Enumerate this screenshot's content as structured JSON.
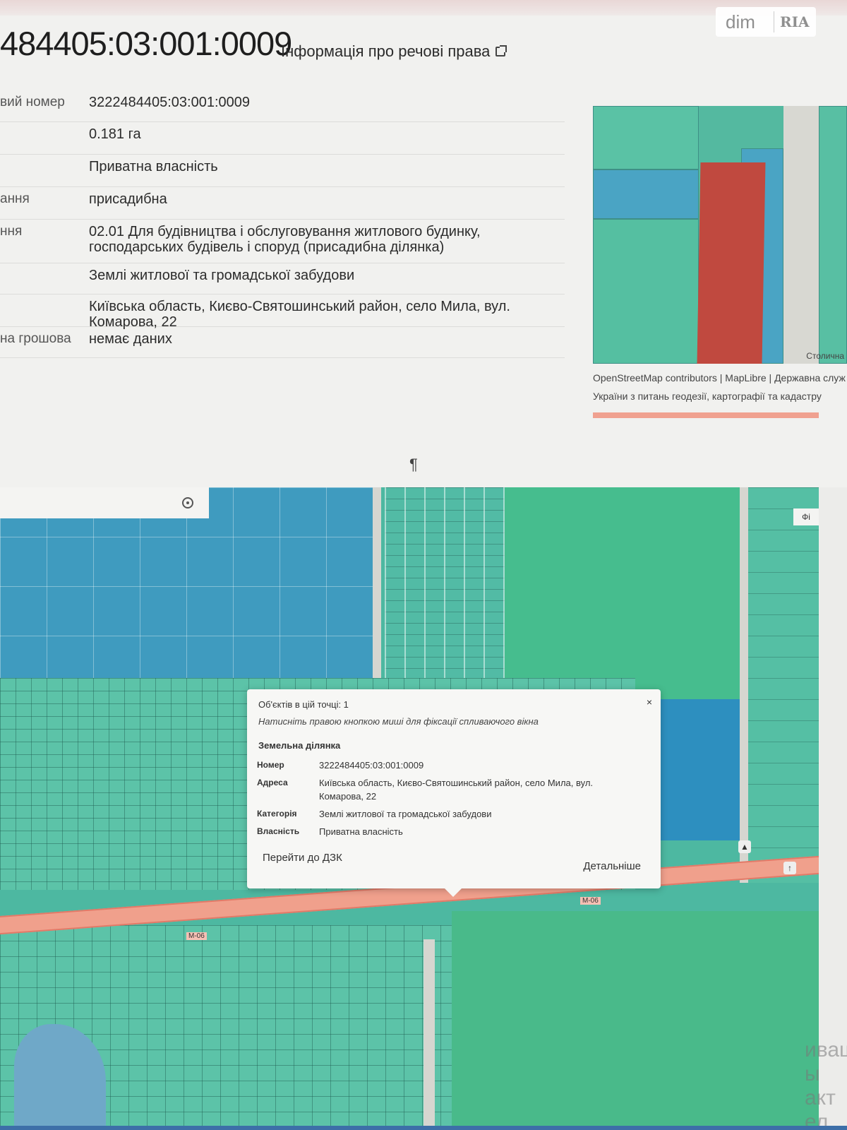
{
  "header": {
    "cadastral_number": "484405:03:001:0009",
    "rights_link": "Інформація про речові права"
  },
  "watermark": {
    "left": "dim",
    "right": "RIA"
  },
  "info_rows": [
    {
      "label": "вий номер",
      "value": "3222484405:03:001:0009"
    },
    {
      "label": "",
      "value": "0.181 га"
    },
    {
      "label": "",
      "value": "Приватна власність"
    },
    {
      "label": "ання",
      "value": "присадибна"
    },
    {
      "label": "ння",
      "value": "02.01 Для будівництва і обслуговування житлового будинку, господарських будівель і споруд (присадибна ділянка)"
    },
    {
      "label": "",
      "value": "Землі житлової та громадської забудови"
    },
    {
      "label": "",
      "value": "Київська область, Києво-Святошинський район, село Мила, вул. Комарова, 22"
    },
    {
      "label": "на грошова",
      "value": "немає даних"
    }
  ],
  "mini_map": {
    "road_label": "Столична",
    "attribution_line1": "OpenStreetMap contributors | MapLibre | Державна служ",
    "attribution_line2": "України з питань геодезії, картографії та кадастру"
  },
  "pilcrow": "¶",
  "big_map": {
    "layers_button": "Фі",
    "road_labels": [
      "М-06",
      "М-06"
    ],
    "right_overlay": [
      "иваш",
      "ы акт",
      "ел \"П"
    ]
  },
  "popup": {
    "count_text": "Об'єктів в цій точці: 1",
    "hint": "Натисніть правою кнопкою миші для фіксації спливаючого вікна",
    "section_title": "Земельна ділянка",
    "close": "×",
    "fields": [
      {
        "key": "Номер",
        "value": "3222484405:03:001:0009"
      },
      {
        "key": "Адреса",
        "value": "Київська область, Києво-Святошинський район, село Мила, вул. Комарова, 22"
      },
      {
        "key": "Категорія",
        "value": "Землі житлової та громадської забудови"
      },
      {
        "key": "Власність",
        "value": "Приватна власність"
      }
    ],
    "dzk_link": "Перейти до ДЗК",
    "details_link": "Детальніше"
  },
  "colors": {
    "selected_parcel": "#c0493f",
    "parcel_fill": "#5cc3a8",
    "road": "#f0a08c"
  }
}
